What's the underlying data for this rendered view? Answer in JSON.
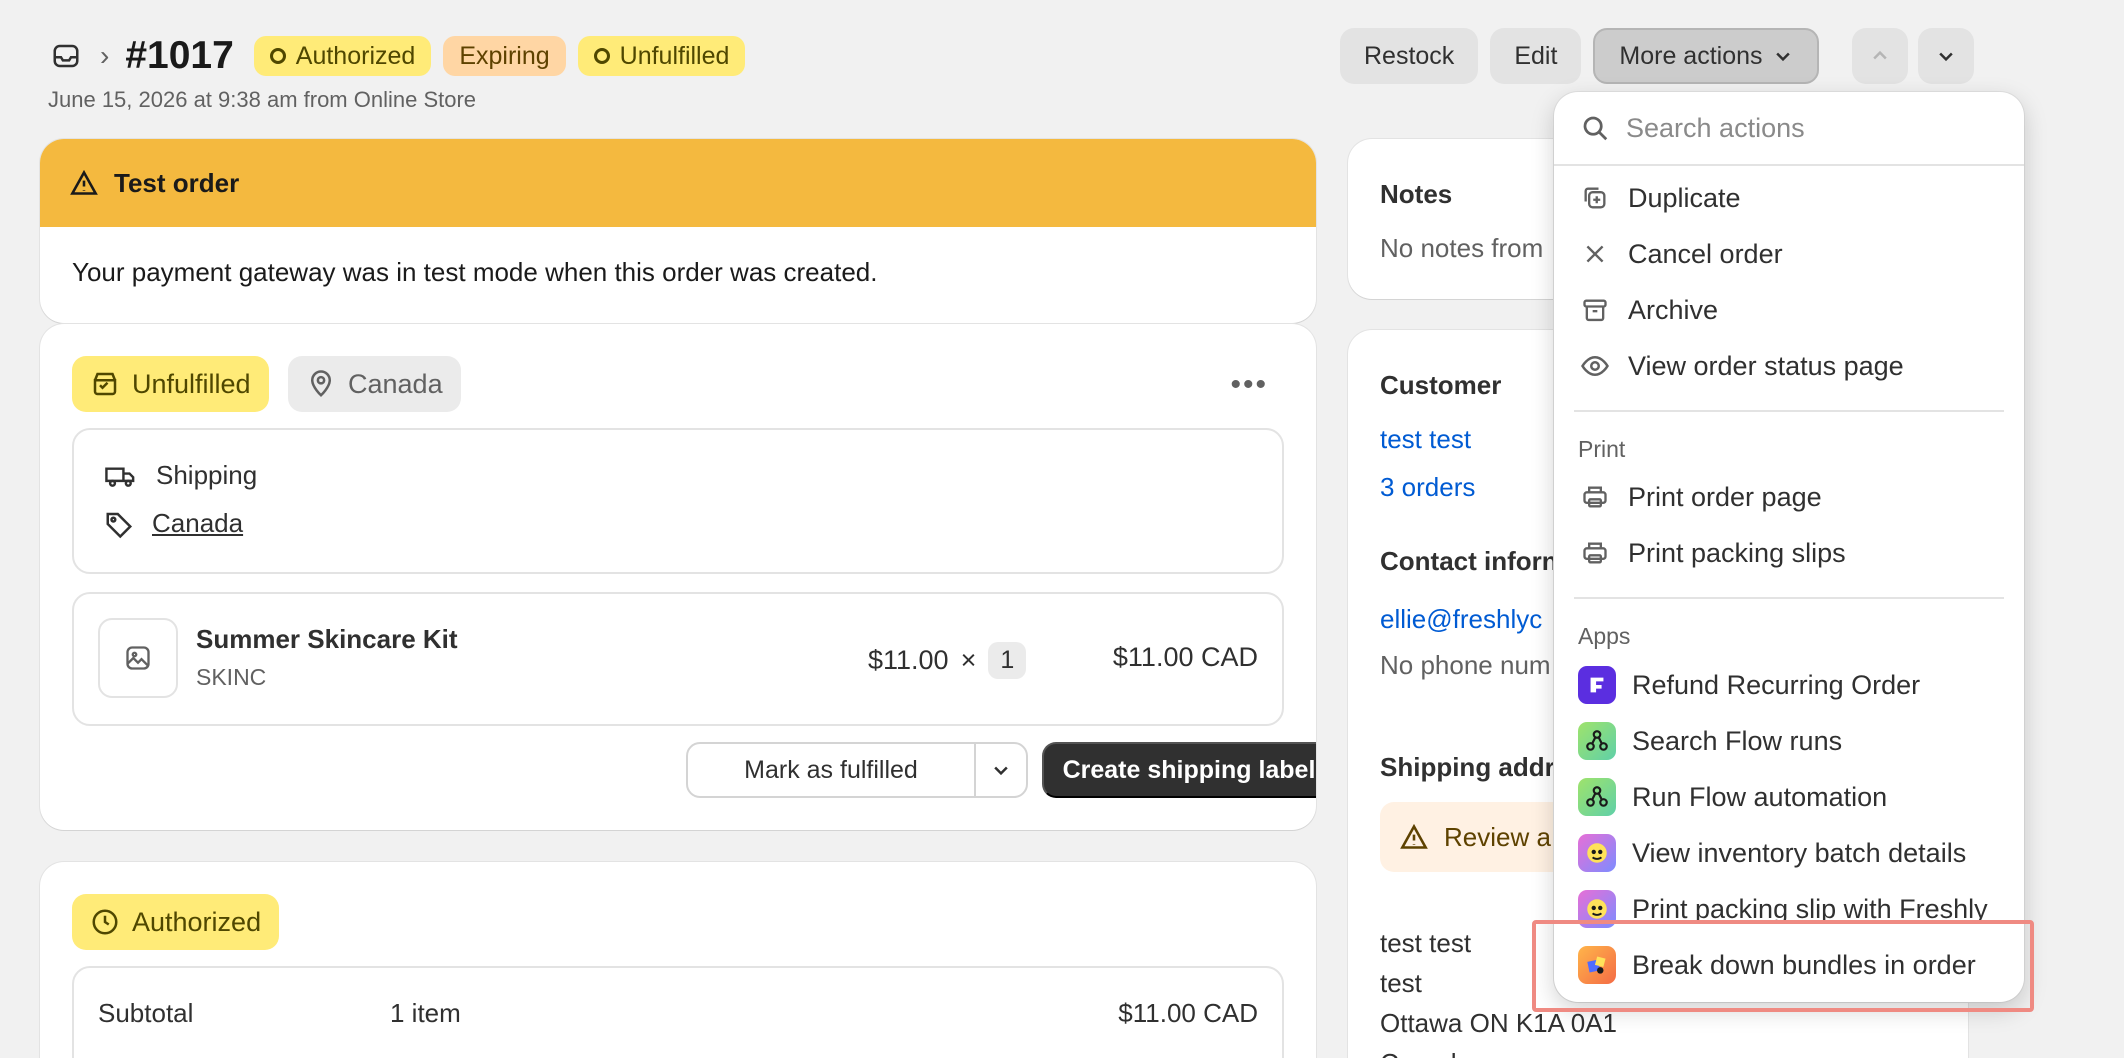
{
  "header": {
    "order_number": "#1017",
    "badges": [
      "Authorized",
      "Expiring",
      "Unfulfilled"
    ],
    "subtitle": "June 15, 2026 at 9:38 am from Online Store",
    "actions": [
      "Restock",
      "Edit",
      "More actions"
    ]
  },
  "test_order": {
    "title": "Test order",
    "message": "Your payment gateway was in test mode when this order was created."
  },
  "fulfillment": {
    "status": "Unfulfilled",
    "location": "Canada",
    "shipping_label": "Shipping",
    "shipping_zone": "Canada",
    "item": {
      "name": "Summer Skincare Kit",
      "sku": "SKINC",
      "price": "$11.00",
      "times": "×",
      "qty": "1",
      "total": "$11.00 CAD"
    },
    "mark_fulfilled": "Mark as fulfilled",
    "create_label": "Create shipping label"
  },
  "payment": {
    "status": "Authorized",
    "subtotal_label": "Subtotal",
    "subtotal_items": "1 item",
    "subtotal_value": "$11.00 CAD"
  },
  "notes": {
    "title": "Notes",
    "text": "No notes from"
  },
  "customer": {
    "title": "Customer",
    "name": "test test",
    "orders": "3 orders",
    "contact_title": "Contact inforn",
    "email": "ellie@freshlyc",
    "phone": "No phone num",
    "shipping_title": "Shipping addr",
    "review": "Review a",
    "address": [
      "test test",
      "test",
      "Ottawa ON K1A 0A1",
      "Canada"
    ]
  },
  "menu": {
    "search_placeholder": "Search actions",
    "items": [
      "Duplicate",
      "Cancel order",
      "Archive",
      "View order status page"
    ],
    "print_section": "Print",
    "print_items": [
      "Print order page",
      "Print packing slips"
    ],
    "apps_section": "Apps",
    "app_items": [
      "Refund Recurring Order",
      "Search Flow runs",
      "Run Flow automation",
      "View inventory batch details",
      "Print packing slip with Freshly",
      "Break down bundles in order"
    ]
  },
  "colors": {
    "warning_banner": "#f4b93f",
    "badge_yellow": "#ffeb78",
    "badge_orange": "#ffd6a4",
    "link": "#005bd3",
    "primary_button": "#303030",
    "highlight": "#ef8a82"
  }
}
